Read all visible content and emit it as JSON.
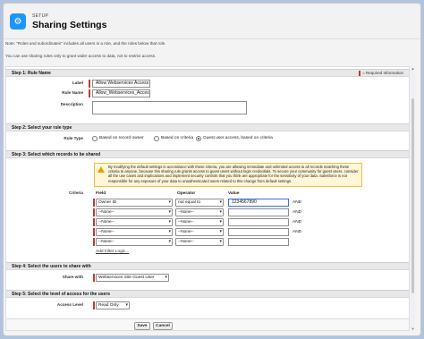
{
  "header": {
    "setup_label": "SETUP",
    "title": "Sharing Settings"
  },
  "notes": {
    "line1": "Note: \"Roles and subordinates\" includes all users in a role, and the roles below that role.",
    "line2": "You can use sharing rules only to grant wider access to data, not to restrict access."
  },
  "step1": {
    "heading": "Step 1: Rule Name",
    "required_info": "= Required Information",
    "label_label": "Label",
    "label_value": "Allow Webservices Access",
    "rule_name_label": "Rule Name",
    "rule_name_value": "Allow_Webservices_Access",
    "description_label": "Description",
    "description_value": ""
  },
  "step2": {
    "heading": "Step 2: Select your rule type",
    "rule_type_label": "Rule Type",
    "options": [
      "Based on record owner",
      "Based on criteria",
      "Guest user access, based on criteria"
    ],
    "selected_index": 2
  },
  "step3": {
    "heading": "Step 3: Select which records to be shared",
    "warning": "By modifying the default settings in accordance with these criteria, you are allowing immediate and unlimited access to all records matching these criteria to anyone, because this sharing rule grants access to guest users without login credentials. To secure your community for guest users, consider all the use cases and implications and implement security controls that you think are appropriate for the sensitivity of your data. Salesforce is not responsible for any exposure of your data to unauthenticated users related to this change from default settings.",
    "criteria_label": "Criteria",
    "col_field": "Field",
    "col_operator": "Operator",
    "col_value": "Value",
    "rows": [
      {
        "field": "Owner ID",
        "operator": "not equal to",
        "value": "1234567890",
        "conj": "AND"
      },
      {
        "field": "--None--",
        "operator": "--None--",
        "value": "",
        "conj": "AND"
      },
      {
        "field": "--None--",
        "operator": "--None--",
        "value": "",
        "conj": "AND"
      },
      {
        "field": "--None--",
        "operator": "--None--",
        "value": "",
        "conj": "AND"
      },
      {
        "field": "--None--",
        "operator": "--None--",
        "value": "",
        "conj": ""
      }
    ],
    "add_filter_logic": "Add Filter Logic..."
  },
  "step4": {
    "heading": "Step 4: Select the users to share with",
    "share_with_label": "Share with",
    "share_with_value": "Webservices Site Guest User"
  },
  "step5": {
    "heading": "Step 5: Select the level of access for the users",
    "access_level_label": "Access Level",
    "access_level_value": "Read Only"
  },
  "footer": {
    "save": "Save",
    "cancel": "Cancel"
  },
  "colors": {
    "brand": "#1b96ff",
    "required": "#c23934",
    "warning_bg": "#fff6d8"
  },
  "icons": {
    "logo": "setup-gear-icon",
    "warning": "warning-icon",
    "caret": "chevron-down-icon"
  }
}
